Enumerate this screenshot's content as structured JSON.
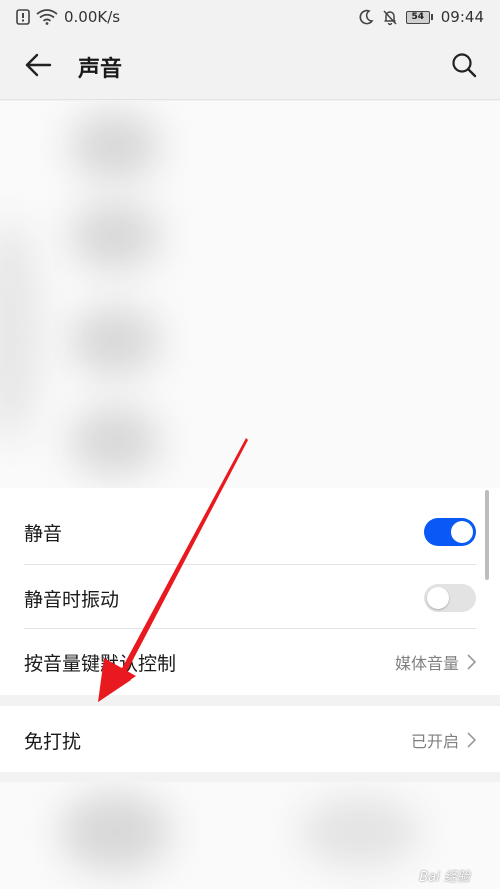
{
  "status_bar": {
    "network_speed": "0.00K/s",
    "battery_level": "54",
    "time": "09:44",
    "icons": [
      "alert-icon",
      "wifi-icon",
      "moon-icon",
      "bell-muted-icon",
      "battery-icon"
    ]
  },
  "app_bar": {
    "title": "声音",
    "back_icon": "arrow-left-icon",
    "search_icon": "search-icon"
  },
  "settings": {
    "mute": {
      "label": "静音",
      "state": "on"
    },
    "vibrate_when_muted": {
      "label": "静音时振动",
      "state": "off"
    },
    "volume_key_default": {
      "label": "按音量键默认控制",
      "value": "媒体音量"
    },
    "do_not_disturb": {
      "label": "免打扰",
      "value": "已开启"
    }
  },
  "colors": {
    "accent": "#0a59f7",
    "annotation_arrow": "#e8191f",
    "background": "#f2f2f2",
    "card": "#ffffff",
    "secondary_text": "#808080"
  },
  "watermark": {
    "text": "Bai 经验"
  }
}
